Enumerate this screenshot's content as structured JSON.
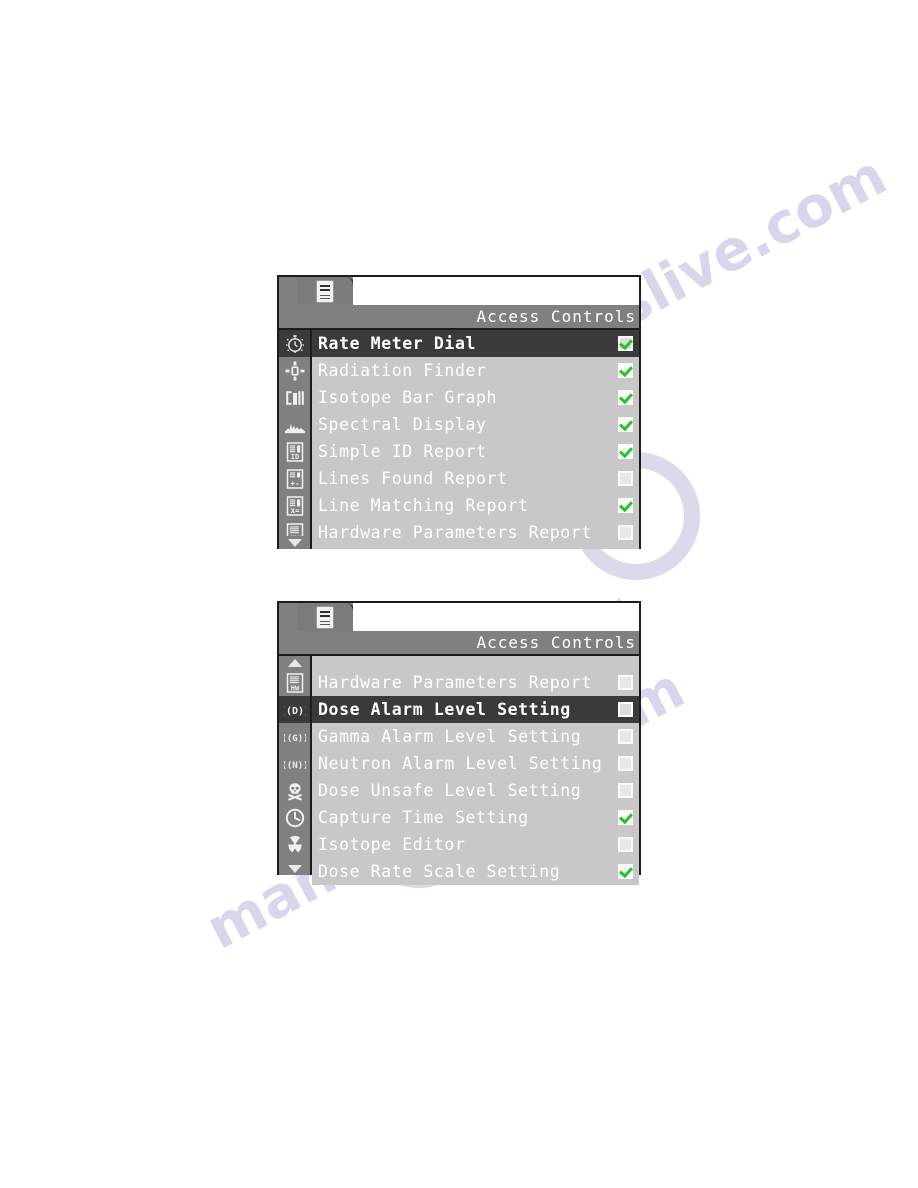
{
  "document": {
    "watermark_text_a": "manualslive.com",
    "watermark_text_b": "manualslive.com"
  },
  "panels": [
    {
      "id": "panel-1",
      "tab": {
        "icon": "document-list-icon",
        "field_value": ""
      },
      "title": "Access Controls",
      "scroll": {
        "up_visible": false,
        "down_visible": true,
        "up_icon": "scroll-up-arrow-icon",
        "down_icon": "scroll-down-arrow-icon"
      },
      "rows": [
        {
          "icon": "rate-meter-dial-icon",
          "label": "Rate Meter Dial",
          "checked": true,
          "selected": true
        },
        {
          "icon": "radiation-finder-icon",
          "label": "Radiation Finder",
          "checked": true,
          "selected": false
        },
        {
          "icon": "isotope-bar-graph-icon",
          "label": "Isotope Bar Graph",
          "checked": true,
          "selected": false
        },
        {
          "icon": "spectral-display-icon",
          "label": "Spectral Display",
          "checked": true,
          "selected": false
        },
        {
          "icon": "simple-id-report-icon",
          "label": "Simple ID Report",
          "checked": true,
          "selected": false
        },
        {
          "icon": "lines-found-report-icon",
          "label": "Lines Found Report",
          "checked": false,
          "selected": false
        },
        {
          "icon": "line-matching-report-icon",
          "label": "Line Matching Report",
          "checked": true,
          "selected": false
        },
        {
          "icon": "hardware-parameters-icon",
          "label": "Hardware Parameters Report",
          "checked": false,
          "selected": false
        }
      ]
    },
    {
      "id": "panel-2",
      "tab": {
        "icon": "document-list-icon",
        "field_value": ""
      },
      "title": "Access Controls",
      "scroll": {
        "up_visible": true,
        "down_visible": true,
        "up_icon": "scroll-up-arrow-icon",
        "down_icon": "scroll-down-arrow-icon"
      },
      "rows": [
        {
          "icon": "hardware-parameters-icon",
          "label": "Hardware Parameters Report",
          "checked": false,
          "selected": false
        },
        {
          "icon": "dose-alarm-level-icon",
          "label": "Dose Alarm Level Setting",
          "checked": false,
          "selected": true
        },
        {
          "icon": "gamma-alarm-level-icon",
          "label": "Gamma Alarm Level Setting",
          "checked": false,
          "selected": false
        },
        {
          "icon": "neutron-alarm-level-icon",
          "label": "Neutron Alarm Level Setting",
          "checked": false,
          "selected": false
        },
        {
          "icon": "dose-unsafe-level-icon",
          "label": "Dose Unsafe Level Setting",
          "checked": false,
          "selected": false
        },
        {
          "icon": "capture-time-icon",
          "label": "Capture Time Setting",
          "checked": true,
          "selected": false
        },
        {
          "icon": "isotope-editor-icon",
          "label": "Isotope Editor",
          "checked": false,
          "selected": false
        },
        {
          "icon": "dose-rate-scale-icon",
          "label": "Dose Rate Scale Setting",
          "checked": true,
          "selected": false
        }
      ]
    }
  ],
  "colors": {
    "panel_chrome": "#808080",
    "list_background": "#c8c8c8",
    "selected_row": "#3a3a3a",
    "row_text": "#ffffff",
    "check_green": "#23c423",
    "border": "#1c1c1c"
  }
}
